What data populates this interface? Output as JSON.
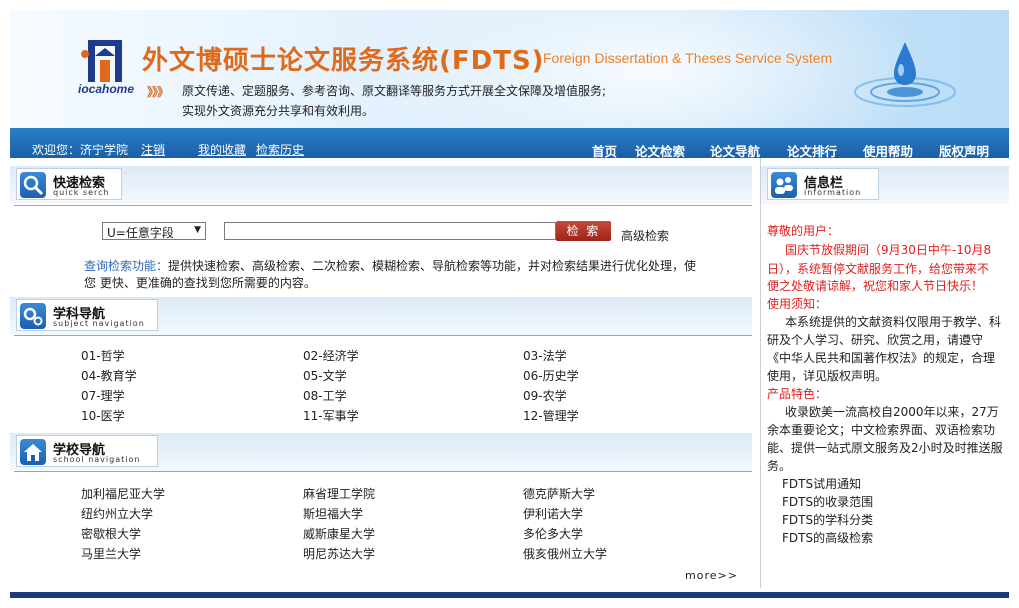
{
  "banner": {
    "logo_text": "iocahome",
    "title_cn": "外文博硕士论文服务系统(FDTS)",
    "title_en": "Foreign Dissertation & Theses Service System",
    "arrows": "》》》",
    "desc_line1": "原文传递、定题服务、参考咨询、原文翻译等服务方式开展全文保障及增值服务;",
    "desc_line2": "实现外文资源充分共享和有效利用。"
  },
  "nav": {
    "welcome": "欢迎您：济宁学院",
    "logout": "注销",
    "favorites": "我的收藏",
    "history": "检索历史",
    "items": [
      "首页",
      "论文检索",
      "论文导航",
      "论文排行",
      "使用帮助",
      "版权声明"
    ]
  },
  "quick_search": {
    "title": "快速检索",
    "subtitle": "quick serch",
    "select_value": "U=任意字段",
    "search_button": "检 索",
    "advanced_link": "高级检索",
    "info_label": "查询检索功能：",
    "info_text": "提供快速检索、高级检索、二次检索、模糊检索、导航检索等功能，并对检索结果进行优化处理，使您 更快、更准确的查找到您所需要的内容。"
  },
  "subject_nav": {
    "title": "学科导航",
    "subtitle": "subject navigation",
    "items": [
      "01-哲学",
      "02-经济学",
      "03-法学",
      "04-教育学",
      "05-文学",
      "06-历史学",
      "07-理学",
      "08-工学",
      "09-农学",
      "10-医学",
      "11-军事学",
      "12-管理学"
    ]
  },
  "school_nav": {
    "title": "学校导航",
    "subtitle": "school navigation",
    "items": [
      "加利福尼亚大学",
      "麻省理工学院",
      "德克萨斯大学",
      "纽约州立大学",
      "斯坦福大学",
      "伊利诺大学",
      "密歇根大学",
      "威斯康星大学",
      "多伦多大学",
      "马里兰大学",
      "明尼苏达大学",
      "俄亥俄州立大学"
    ],
    "more": "more>>"
  },
  "info_panel": {
    "title": "信息栏",
    "subtitle": "information",
    "greeting": "尊敬的用户：",
    "notice_lines": [
      "国庆节放假期间（9月30日中午-10月8",
      "日），系统暂停文献服务工作，给您带来不",
      "便之处敬请谅解，祝您和家人节日快乐！"
    ],
    "usage_title": "使用须知：",
    "usage_lines": [
      "本系统提供的文献资料仅限用于教学、科",
      "研及个人学习、研究、欣赏之用，请遵守",
      "《中华人民共和国著作权法》的规定，合理",
      "使用，详见版权声明。"
    ],
    "feature_title": "产品特色：",
    "feature_lines": [
      "收录欧美一流高校自2000年以来，27万",
      "余本重要论文；中文检索界面、双语检索功",
      "能、提供一站式原文服务及2小时及时推送服",
      "务。"
    ],
    "links": [
      "FDTS试用通知",
      "FDTS的收录范围",
      "FDTS的学科分类",
      "FDTS的高级检索"
    ]
  }
}
